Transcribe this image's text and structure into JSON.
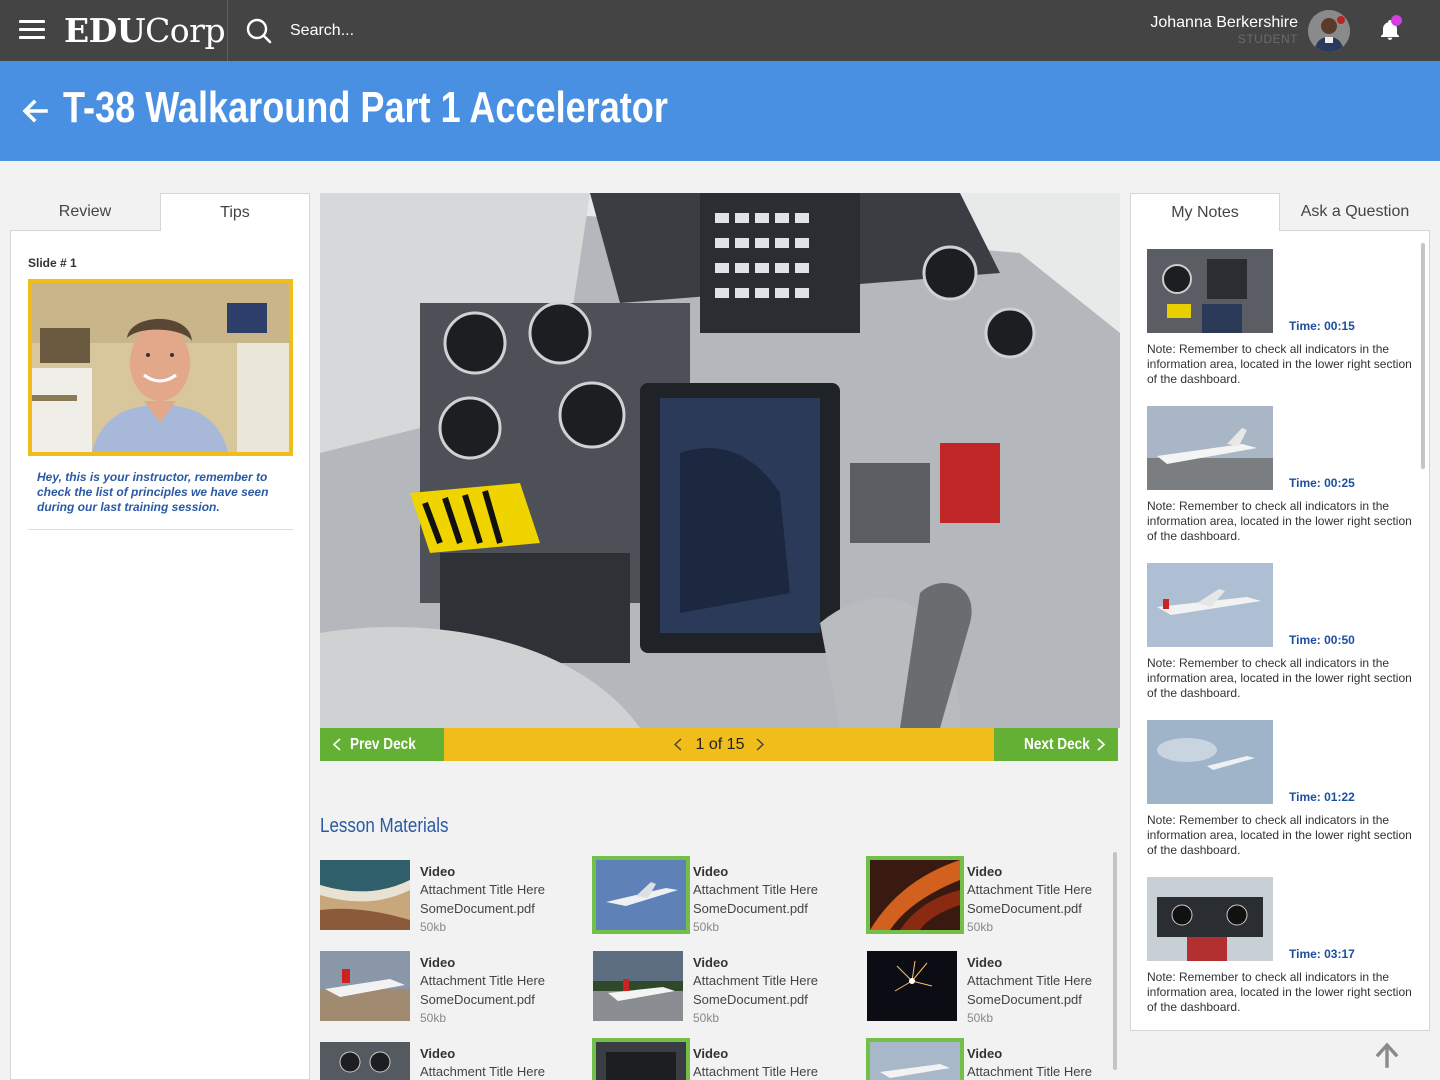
{
  "app": {
    "brand_bold": "EDU",
    "brand_rest": "Corp"
  },
  "search": {
    "placeholder": "Search..."
  },
  "user": {
    "name": "Johanna Berkershire",
    "role": "STUDENT"
  },
  "page": {
    "title": "T-38 Walkaround Part 1 Accelerator"
  },
  "left_panel": {
    "tabs": [
      {
        "label": "Review",
        "active": false
      },
      {
        "label": "Tips",
        "active": true
      }
    ],
    "slide_label": "Slide # 1",
    "tip_text": "Hey, this is your instructor, remember to check the list of principles we have seen during our last training session."
  },
  "viewer": {
    "prev_label": "Prev Deck",
    "next_label": "Next Deck",
    "pager": "1 of 15"
  },
  "materials": {
    "title": "Lesson Materials",
    "items": [
      {
        "type": "Video",
        "title": "Attachment Title Here",
        "file": "SomeDocument.pdf",
        "size": "50kb",
        "selected": false
      },
      {
        "type": "Video",
        "title": "Attachment Title Here",
        "file": "SomeDocument.pdf",
        "size": "50kb",
        "selected": true
      },
      {
        "type": "Video",
        "title": "Attachment Title Here",
        "file": "SomeDocument.pdf",
        "size": "50kb",
        "selected": true
      },
      {
        "type": "Video",
        "title": "Attachment Title Here",
        "file": "SomeDocument.pdf",
        "size": "50kb",
        "selected": false
      },
      {
        "type": "Video",
        "title": "Attachment Title Here",
        "file": "SomeDocument.pdf",
        "size": "50kb",
        "selected": false
      },
      {
        "type": "Video",
        "title": "Attachment Title Here",
        "file": "SomeDocument.pdf",
        "size": "50kb",
        "selected": false
      },
      {
        "type": "Video",
        "title": "Attachment Title Here",
        "file": "",
        "size": "",
        "selected": false
      },
      {
        "type": "Video",
        "title": "Attachment Title Here",
        "file": "",
        "size": "",
        "selected": true
      },
      {
        "type": "Video",
        "title": "Attachment Title Here",
        "file": "",
        "size": "",
        "selected": true
      }
    ]
  },
  "right_panel": {
    "tabs": [
      {
        "label": "My Notes",
        "active": true
      },
      {
        "label": "Ask a Question",
        "active": false
      }
    ],
    "notes": [
      {
        "time": "Time: 00:15",
        "text": "Note: Remember to check all indicators in the information area, located in the lower right section of the dashboard."
      },
      {
        "time": "Time: 00:25",
        "text": "Note: Remember to check all indicators in the information area, located in the lower right section of the dashboard."
      },
      {
        "time": "Time: 00:50",
        "text": "Note: Remember to check all indicators in the information area, located in the lower right section of the dashboard."
      },
      {
        "time": "Time: 01:22",
        "text": "Note: Remember to check all indicators in the information area, located in the lower right section of the dashboard."
      },
      {
        "time": "Time: 03:17",
        "text": "Note: Remember to check all indicators in the information area, located in the lower right section of the dashboard."
      }
    ]
  },
  "colors": {
    "topbar": "#444444",
    "title_bar": "#4a90e2",
    "accent_green": "#64b035",
    "accent_yellow": "#f0bd1a",
    "link_blue": "#2a5aa3",
    "notification": "#d43fe0"
  },
  "icons": {
    "menu": "hamburger-menu-icon",
    "search": "search-icon",
    "back": "arrow-left-icon",
    "bell": "bell-icon",
    "scroll_top": "arrow-up-icon"
  }
}
